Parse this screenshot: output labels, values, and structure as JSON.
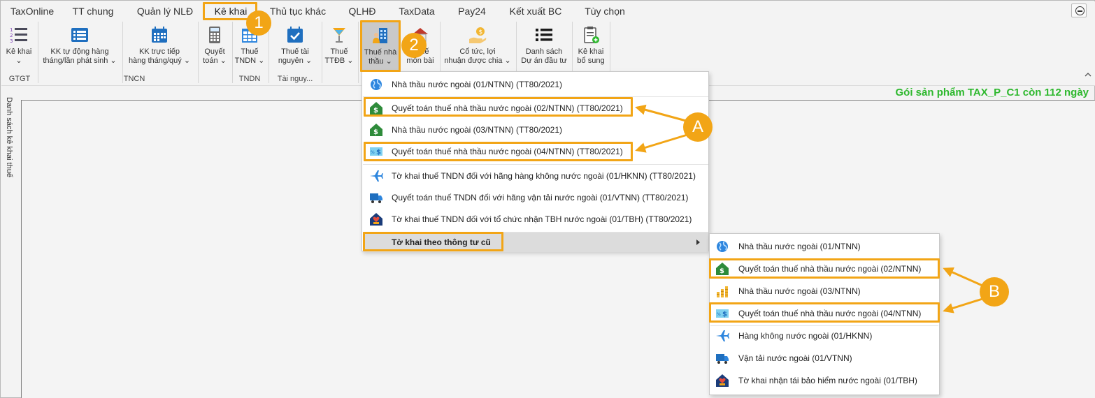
{
  "menu_tabs": [
    {
      "label": "TaxOnline"
    },
    {
      "label": "TT chung"
    },
    {
      "label": "Quản lý NLĐ"
    },
    {
      "label": "Kê khai"
    },
    {
      "label": "Thủ tục khác"
    },
    {
      "label": "QLHĐ"
    },
    {
      "label": "TaxData"
    },
    {
      "label": "Pay24"
    },
    {
      "label": "Kết xuất BC"
    },
    {
      "label": "Tùy chọn"
    }
  ],
  "ribbon": {
    "buttons": [
      {
        "label": "Kê khai\n⌄",
        "icon": "list-numbered-icon"
      },
      {
        "label": "KK tự động hàng\ntháng/lần phát sinh ⌄",
        "icon": "auto-declare-icon"
      },
      {
        "label": "KK trực tiếp\nhàng tháng/quý ⌄",
        "icon": "calendar-icon"
      },
      {
        "label": "Quyết\ntoán ⌄",
        "icon": "calculator-icon"
      },
      {
        "label": "Thuế\nTNDN ⌄",
        "icon": "grid-calendar-icon"
      },
      {
        "label": "Thuế tài\nnguyên ⌄",
        "icon": "check-calendar-icon"
      },
      {
        "label": "Thuế\nTTĐB ⌄",
        "icon": "cocktail-icon"
      },
      {
        "label": "Thuế nhà\nthầu ⌄",
        "icon": "contractor-icon"
      },
      {
        "label": "Thuế\nmôn bài",
        "icon": "house-icon"
      },
      {
        "label": "Cổ tức, lợi\nnhuận được chia ⌄",
        "icon": "dividend-icon"
      },
      {
        "label": "Danh sách\nDự án đầu tư",
        "icon": "bullet-list-icon"
      },
      {
        "label": "Kê khai\nbổ sung",
        "icon": "clipboard-add-icon"
      }
    ],
    "groups": [
      {
        "label": "GTGT"
      },
      {
        "label": "TNCN"
      },
      {
        "label": "TNDN"
      },
      {
        "label": "Tài nguy..."
      }
    ]
  },
  "promo_text": "Gói sản phẩm TAX_P_C1 còn 112 ngày",
  "side_tab_label": "Danh sách kê khai thuế",
  "dropdown": {
    "items": [
      {
        "label": "Nhà thầu nước ngoài (01/NTNN) (TT80/2021)",
        "icon": "globe-icon"
      },
      {
        "label": "Quyết toán thuế nhà thầu nước ngoài (02/NTNN) (TT80/2021)",
        "icon": "money-house-icon"
      },
      {
        "label": "Nhà thầu nước ngoài (03/NTNN) (TT80/2021)",
        "icon": "money-house-icon"
      },
      {
        "label": "Quyết toán thuế nhà thầu nước ngoài (04/NTNN) (TT80/2021)",
        "icon": "percent-dollar-icon"
      },
      {
        "label": "Tờ khai thuế TNDN đối với hãng hàng không nước ngoài (01/HKNN) (TT80/2021)",
        "icon": "airplane-icon"
      },
      {
        "label": "Quyết toán thuế TNDN đối với hãng vận tải nước ngoài (01/VTNN) (TT80/2021)",
        "icon": "truck-icon"
      },
      {
        "label": "Tờ khai thuế TNDN đối với tổ chức nhận TBH nước ngoài (01/TBH) (TT80/2021)",
        "icon": "insurance-house-icon"
      }
    ],
    "old_circular": {
      "label": "Tờ khai theo thông tư cũ"
    }
  },
  "submenu": {
    "items": [
      {
        "label": "Nhà thầu nước ngoài (01/NTNN)",
        "icon": "globe-icon"
      },
      {
        "label": "Quyết toán thuế nhà thầu nước ngoài (02/NTNN)",
        "icon": "money-house-icon"
      },
      {
        "label": "Nhà thầu nước ngoài (03/NTNN)",
        "icon": "coins-icon"
      },
      {
        "label": "Quyết toán thuế nhà thầu nước ngoài (04/NTNN)",
        "icon": "percent-dollar-icon"
      },
      {
        "label": "Hàng không nước ngoài (01/HKNN)",
        "icon": "airplane-icon"
      },
      {
        "label": "Vận tải nước ngoài (01/VTNN)",
        "icon": "truck-icon"
      },
      {
        "label": "Tờ khai nhận tái bảo hiểm nước ngoài (01/TBH)",
        "icon": "insurance-house-icon"
      }
    ]
  },
  "annotations": {
    "step1": "1",
    "step2": "2",
    "label_a": "A",
    "label_b": "B",
    "color": "#f2a516"
  },
  "colors": {
    "promo_green": "#2eb82e",
    "accent_blue": "#1f6fbf",
    "money_green": "#2e8b3a",
    "highlight_orange": "#f2a516"
  }
}
